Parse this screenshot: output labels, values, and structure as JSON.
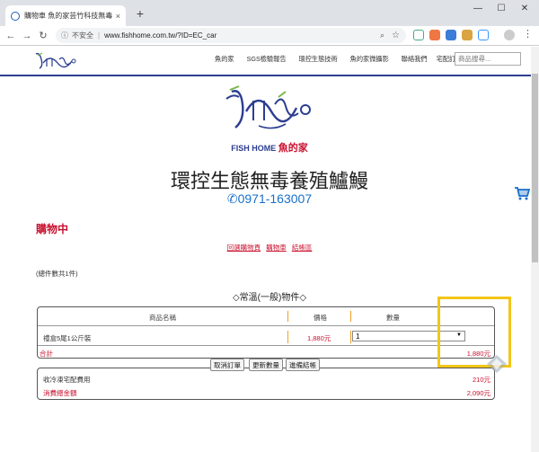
{
  "browser": {
    "tab_title": "購物車 魚的家芸竹科技無毒養殖",
    "tab_close": "×",
    "new_tab": "+",
    "win_min": "—",
    "win_max": "☐",
    "win_close": "✕",
    "security": "不安全",
    "url": "www.fishhome.com.tw/?ID=EC_car"
  },
  "site": {
    "menu": [
      "魚的家",
      "SGS檢驗報告",
      "環控生態技術",
      "魚的家微攝影",
      "聯絡我們",
      "宅配訂購"
    ],
    "search_placeholder": "商品搜尋...",
    "brand": "FISH HOME",
    "brand_cn": "魚的家",
    "headline": "環控生態無毒養殖鱸鰻",
    "phone": "0971-163007",
    "accent": "#c8102e",
    "navy": "#2c3e91"
  },
  "cart": {
    "heading": "購物中",
    "links": [
      "回選購物頁",
      "購物車",
      "結帳區"
    ],
    "count_text": "(總件數共1件)",
    "section_title": "◇常溫(一般)物件◇",
    "columns": [
      "商品名稱",
      "價格",
      "數量"
    ],
    "items": [
      {
        "name": "禮盒5尾1公斤裝",
        "price": "1,880元",
        "qty": "1"
      }
    ],
    "subtotal_label": "合計",
    "subtotal_value": "1,880元",
    "shipping_label": "收冷凍宅配費用",
    "shipping_value": "210元",
    "total_label": "消費總金額",
    "total_value": "2,090元",
    "buttons": [
      "取消訂單",
      "更新數量",
      "進備結帳"
    ]
  }
}
